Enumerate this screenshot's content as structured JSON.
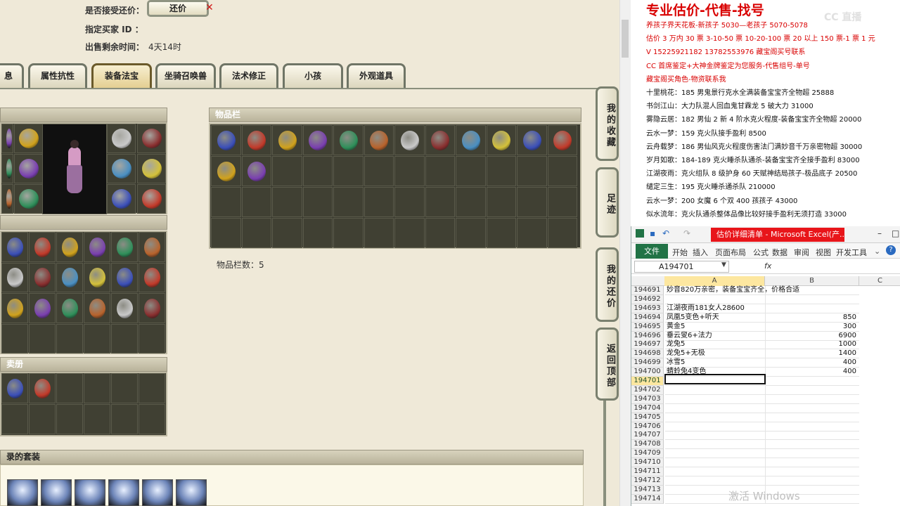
{
  "game": {
    "accept_haggle_label": "是否接受还价：",
    "haggle_button": "还价",
    "buyer_id_label": "指定买家 ID ：",
    "time_left_label": "出售剩余时间：",
    "time_left_value": "4天14时",
    "tabs": [
      {
        "label": "息"
      },
      {
        "label": "属性抗性"
      },
      {
        "label": "装备法宝"
      },
      {
        "label": "坐骑召唤兽"
      },
      {
        "label": "法术修正"
      },
      {
        "label": "小孩"
      },
      {
        "label": "外观道具"
      }
    ],
    "inventory_title": "物品栏",
    "inventory_count": "物品栏数：5",
    "album_title": "卖册",
    "suits_title": "录的套装",
    "side_buttons": [
      "我的收藏",
      "足迹",
      "我的还价",
      "返回顶部"
    ]
  },
  "ad": {
    "headline": "专业估价-代售-找号",
    "lines": [
      {
        "text": "养孩子界天花板-新孩子 5030—老孩子 5070-5078",
        "color": "#d90000"
      },
      {
        "text": "估价 3 万内 30 票 3-10-50 票 10-20-100 票 20 以上 150 票-1 票 1 元",
        "color": "#d90000"
      },
      {
        "text": "V 15225921182     13782553976    藏宝阁买号联系",
        "color": "#d90000"
      },
      {
        "text": "CC 首席鉴定+大神金牌鉴定为您服务-代售组号-单号",
        "color": "#d90000"
      },
      {
        "text": "藏宝阁买角色-物资联系我",
        "color": "#d90000"
      },
      {
        "text": "十里桃花：185 男鬼景行克水全满装备宝宝齐全物超 25888",
        "color": "#111111"
      },
      {
        "text": "书剑江山：大力队混人回血鬼甘霖龙 5 破大力 31000",
        "color": "#111111"
      },
      {
        "text": "雾隐云居：182 男仙 2 新 4 阶水克火程度-装备宝宝齐全物超 20000",
        "color": "#111111"
      },
      {
        "text": "云水一梦：159 克火队接手盈利 8500",
        "color": "#111111"
      },
      {
        "text": "云舟载梦：186 男仙风克火程度伤害法门满妙音千万亲密物超 30000",
        "color": "#111111"
      },
      {
        "text": "岁月如歌：184-189 克火睡杀队通杀-装备宝宝齐全接手盈利 83000",
        "color": "#111111"
      },
      {
        "text": "江湖夜雨：克火组队 8 级护身 60 天赋神结局孩子-极品底子 20500",
        "color": "#111111"
      },
      {
        "text": "缱定三生：195 克火睡杀通杀队 210000",
        "color": "#111111"
      },
      {
        "text": "云水一梦：200 女魔 6 个双 400 孩孩子 43000",
        "color": "#111111"
      },
      {
        "text": "似水流年：克火队通杀整体品像比较好接手盈利无须打造 33000",
        "color": "#111111"
      }
    ],
    "logo": "CC 直播"
  },
  "excel": {
    "doc_title": "估价详细清单 - Microsoft Excel(产...",
    "file_tab": "文件",
    "menu": [
      "开始",
      "插入",
      "页面布局",
      "公式",
      "数据",
      "审阅",
      "视图",
      "开发工具"
    ],
    "name_box": "A194701",
    "fx": "fx",
    "col_headers": [
      "A",
      "B",
      "C"
    ],
    "rows": [
      {
        "num": "194691",
        "a": "妙音820万亲密，装备宝宝齐全，价格合适",
        "b": ""
      },
      {
        "num": "194692",
        "a": "",
        "b": ""
      },
      {
        "num": "194693",
        "a": "江湖夜雨181女人28600",
        "b": ""
      },
      {
        "num": "194694",
        "a": "凤凰5变色+听天",
        "b": "850"
      },
      {
        "num": "194695",
        "a": "黄金5",
        "b": "300"
      },
      {
        "num": "194696",
        "a": "垂云叟6+法力",
        "b": "6900"
      },
      {
        "num": "194697",
        "a": "龙兔5",
        "b": "1000"
      },
      {
        "num": "194698",
        "a": "龙兔5+无极",
        "b": "1400"
      },
      {
        "num": "194699",
        "a": "冰雪5",
        "b": "400"
      },
      {
        "num": "194700",
        "a": "蜻蛉兔4变色",
        "b": "400"
      },
      {
        "num": "194701",
        "a": "",
        "b": ""
      },
      {
        "num": "194702",
        "a": "",
        "b": ""
      },
      {
        "num": "194703",
        "a": "",
        "b": ""
      },
      {
        "num": "194704",
        "a": "",
        "b": ""
      },
      {
        "num": "194705",
        "a": "",
        "b": ""
      },
      {
        "num": "194706",
        "a": "",
        "b": ""
      },
      {
        "num": "194707",
        "a": "",
        "b": ""
      },
      {
        "num": "194708",
        "a": "",
        "b": ""
      },
      {
        "num": "194709",
        "a": "",
        "b": ""
      },
      {
        "num": "194710",
        "a": "",
        "b": ""
      },
      {
        "num": "194711",
        "a": "",
        "b": ""
      },
      {
        "num": "194712",
        "a": "",
        "b": ""
      },
      {
        "num": "194713",
        "a": "",
        "b": ""
      },
      {
        "num": "194714",
        "a": "",
        "b": ""
      }
    ]
  },
  "watermark": "激活 Windows",
  "colors": {
    "accent_red": "#d90000",
    "excel_green": "#217346",
    "excel_title_red": "#e8151a"
  }
}
